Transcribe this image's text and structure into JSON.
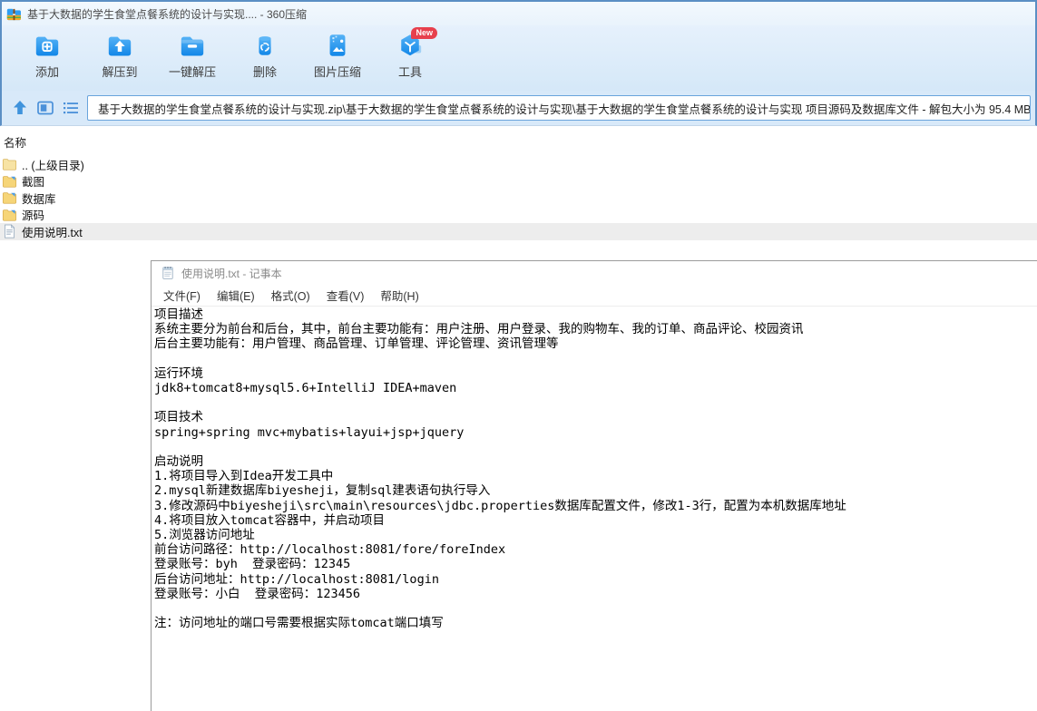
{
  "window": {
    "title": "基于大数据的学生食堂点餐系统的设计与实现.... - 360压缩"
  },
  "toolbar": {
    "buttons": [
      {
        "label": "添加",
        "icon": "add-folder-icon"
      },
      {
        "label": "解压到",
        "icon": "extract-to-icon"
      },
      {
        "label": "一键解压",
        "icon": "one-click-extract-icon"
      },
      {
        "label": "删除",
        "icon": "delete-icon"
      },
      {
        "label": "图片压缩",
        "icon": "image-compress-icon"
      },
      {
        "label": "工具",
        "icon": "tools-icon",
        "badge": "New"
      }
    ]
  },
  "address_bar": {
    "path": "基于大数据的学生食堂点餐系统的设计与实现.zip\\基于大数据的学生食堂点餐系统的设计与实现\\基于大数据的学生食堂点餐系统的设计与实现 项目源码及数据库文件 - 解包大小为 95.4 MB"
  },
  "file_list": {
    "column_header": "名称",
    "items": [
      {
        "name": ".. (上级目录)",
        "type": "parent-folder",
        "selected": false
      },
      {
        "name": "截图",
        "type": "folder",
        "selected": false
      },
      {
        "name": "数据库",
        "type": "folder",
        "selected": false
      },
      {
        "name": "源码",
        "type": "folder",
        "selected": false
      },
      {
        "name": "使用说明.txt",
        "type": "text-file",
        "selected": true
      }
    ]
  },
  "notepad": {
    "title": "使用说明.txt - 记事本",
    "menu_items": [
      "文件(F)",
      "编辑(E)",
      "格式(O)",
      "查看(V)",
      "帮助(H)"
    ],
    "content_lines": [
      "项目描述",
      "系统主要分为前台和后台，其中，前台主要功能有：用户注册、用户登录、我的购物车、我的订单、商品评论、校园资讯",
      "后台主要功能有：用户管理、商品管理、订单管理、评论管理、资讯管理等",
      "",
      "运行环境",
      "jdk8+tomcat8+mysql5.6+IntelliJ IDEA+maven",
      "",
      "项目技术",
      "spring+spring mvc+mybatis+layui+jsp+jquery",
      "",
      "启动说明",
      "1.将项目导入到Idea开发工具中",
      "2.mysql新建数据库biyesheji，复制sql建表语句执行导入",
      "3.修改源码中biyesheji\\src\\main\\resources\\jdbc.properties数据库配置文件，修改1-3行，配置为本机数据库地址",
      "4.将项目放入tomcat容器中，并启动项目",
      "5.浏览器访问地址",
      "前台访问路径：http://localhost:8081/fore/foreIndex",
      "登录账号：byh  登录密码：12345",
      "后台访问地址：http://localhost:8081/login",
      "登录账号：小白  登录密码：123456",
      "",
      "注：访问地址的端口号需要根据实际tomcat端口填写"
    ]
  },
  "colors": {
    "accent_blue": "#1e96f0",
    "badge_red": "#e7404d",
    "selected_row": "#ededed",
    "chrome_border": "#5b8fc4"
  }
}
